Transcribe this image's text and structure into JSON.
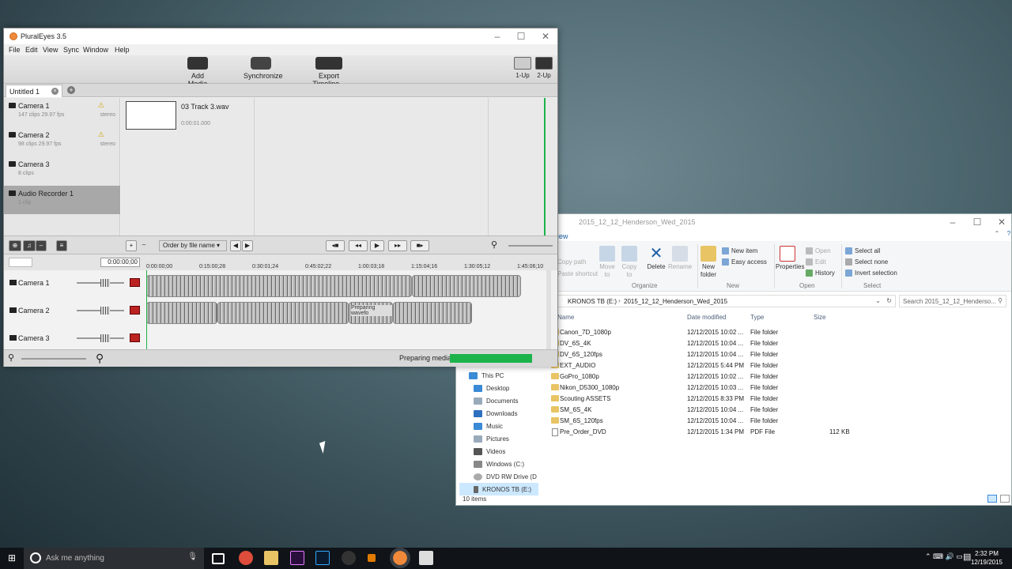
{
  "pluraleyes": {
    "title": "PluralEyes 3.5",
    "menu": [
      "File",
      "Edit",
      "View",
      "Sync",
      "Window",
      "Help"
    ],
    "toolbar": {
      "add_media": "Add Media",
      "synchronize": "Synchronize",
      "export": "Export Timeline...",
      "view_1up": "1-Up",
      "view_2up": "2-Up"
    },
    "tab": "Untitled 1",
    "cameras": [
      {
        "name": "Camera 1",
        "meta": "147 clips   29.97 fps",
        "audio": "stereo",
        "warn": true
      },
      {
        "name": "Camera 2",
        "meta": "98 clips   29.97 fps",
        "audio": "stereo",
        "warn": true
      },
      {
        "name": "Camera 3",
        "meta": "8 clips",
        "audio": "",
        "warn": false
      },
      {
        "name": "Audio Recorder 1",
        "meta": "1 clip",
        "audio": "",
        "warn": false
      }
    ],
    "clip": {
      "name": "03 Track 3.wav",
      "duration": "0:00:01.000"
    },
    "order_dropdown": "Order by file name",
    "timecode": "0:00:00;00",
    "ruler": [
      "0:00:00;00",
      "0:15:00;28",
      "0:30:01;24",
      "0:45:02;22",
      "1:00:03;18",
      "1:15:04;16",
      "1:30:05;12",
      "1:45:06;10"
    ],
    "tracks": [
      "Camera 1",
      "Camera 2",
      "Camera 3"
    ],
    "preparing_waveform": "Preparing wavefo",
    "status": "Preparing media",
    "progress_pct": 100
  },
  "explorer": {
    "title": "2015_12_12_Henderson_Wed_2015",
    "view_tab": "View",
    "ribbon": {
      "copy_path": "Copy path",
      "paste_shortcut": "Paste shortcut",
      "move_to": "Move to",
      "copy_to": "Copy to",
      "delete": "Delete",
      "rename": "Rename",
      "new_folder": "New folder",
      "new_item": "New item",
      "easy_access": "Easy access",
      "properties": "Properties",
      "open": "Open",
      "edit": "Edit",
      "history": "History",
      "select_all": "Select all",
      "select_none": "Select none",
      "invert_selection": "Invert selection",
      "groups": {
        "organize": "Organize",
        "new": "New",
        "open": "Open",
        "select": "Select"
      }
    },
    "address": [
      "KRONOS TB (E:)",
      "2015_12_12_Henderson_Wed_2015"
    ],
    "search_placeholder": "Search 2015_12_12_Henderso...",
    "columns": {
      "name": "Name",
      "date": "Date modified",
      "type": "Type",
      "size": "Size"
    },
    "nav": [
      "This PC",
      "Desktop",
      "Documents",
      "Downloads",
      "Music",
      "Pictures",
      "Videos",
      "Windows (C:)",
      "DVD RW Drive (D",
      "KRONOS TB (E:)"
    ],
    "files": [
      {
        "name": "Canon_7D_1080p",
        "date": "12/12/2015 10:02 ...",
        "type": "File folder",
        "size": ""
      },
      {
        "name": "DV_6S_4K",
        "date": "12/12/2015 10:04 ...",
        "type": "File folder",
        "size": ""
      },
      {
        "name": "DV_6S_120fps",
        "date": "12/12/2015 10:04 ...",
        "type": "File folder",
        "size": ""
      },
      {
        "name": "EXT_AUDIO",
        "date": "12/12/2015 5:44 PM",
        "type": "File folder",
        "size": ""
      },
      {
        "name": "GoPro_1080p",
        "date": "12/12/2015 10:02 ...",
        "type": "File folder",
        "size": ""
      },
      {
        "name": "Nikon_D5300_1080p",
        "date": "12/12/2015 10:03 ...",
        "type": "File folder",
        "size": ""
      },
      {
        "name": "Scouting ASSETS",
        "date": "12/12/2015 8:33 PM",
        "type": "File folder",
        "size": ""
      },
      {
        "name": "SM_6S_4K",
        "date": "12/12/2015 10:04 ...",
        "type": "File folder",
        "size": ""
      },
      {
        "name": "SM_6S_120fps",
        "date": "12/12/2015 10:04 ...",
        "type": "File folder",
        "size": ""
      },
      {
        "name": "Pre_Order_DVD",
        "date": "12/12/2015 1:34 PM",
        "type": "PDF File",
        "size": "112 KB"
      }
    ],
    "status": "10 items"
  },
  "taskbar": {
    "search": "Ask me anything",
    "time": "2:32 PM",
    "date": "12/19/2015"
  }
}
